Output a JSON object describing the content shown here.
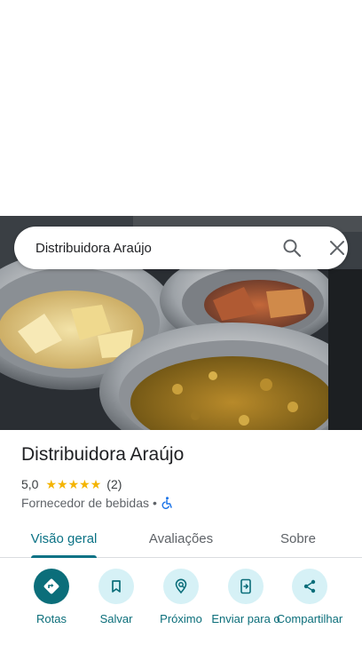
{
  "search": {
    "query": "Distribuidora Araújo",
    "search_icon": "search-icon",
    "close_icon": "close-icon"
  },
  "place": {
    "name": "Distribuidora Araújo",
    "rating": "5,0",
    "stars_filled": 5,
    "stars_total": 5,
    "review_count": "(2)",
    "category": "Fornecedor de bebidas",
    "separator": "•",
    "accessibility_icon": "wheelchair-icon"
  },
  "tabs": [
    {
      "label": "Visão geral",
      "active": true
    },
    {
      "label": "Avaliações",
      "active": false
    },
    {
      "label": "Sobre",
      "active": false
    }
  ],
  "actions": [
    {
      "label": "Rotas",
      "icon": "directions-icon"
    },
    {
      "label": "Salvar",
      "icon": "bookmark-icon"
    },
    {
      "label": "Próximo",
      "icon": "nearby-icon"
    },
    {
      "label": "Enviar para o",
      "icon": "send-to-phone-icon"
    },
    {
      "label": "Compartilhar",
      "icon": "share-icon"
    }
  ],
  "colors": {
    "accent": "#0b6e7a",
    "accent_light": "#d6f1f6",
    "star": "#f4b400",
    "tab_active": "#0b7285"
  }
}
